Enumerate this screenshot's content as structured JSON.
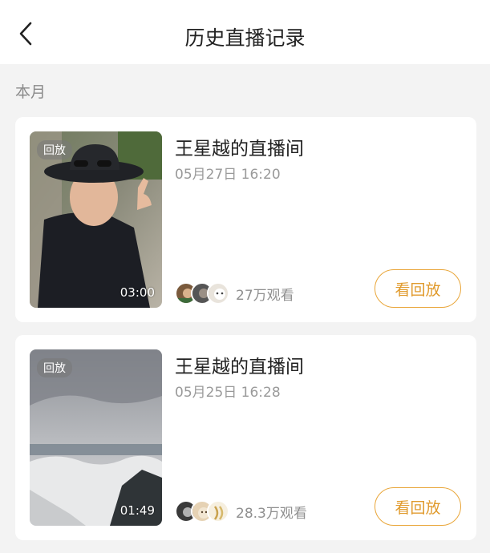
{
  "header": {
    "title": "历史直播记录",
    "back_icon": "chevron-left-icon"
  },
  "section": {
    "label": "本月"
  },
  "records": [
    {
      "badge": "回放",
      "duration": "03:00",
      "room_name": "王星越的直播间",
      "time": "05月27日 16:20",
      "views": "27万观看",
      "button": "看回放"
    },
    {
      "badge": "回放",
      "duration": "01:49",
      "room_name": "王星越的直播间",
      "time": "05月25日 16:28",
      "views": "28.3万观看",
      "button": "看回放"
    }
  ],
  "colors": {
    "accent": "#e09a2c",
    "background": "#f3f3f3",
    "card": "#ffffff"
  }
}
